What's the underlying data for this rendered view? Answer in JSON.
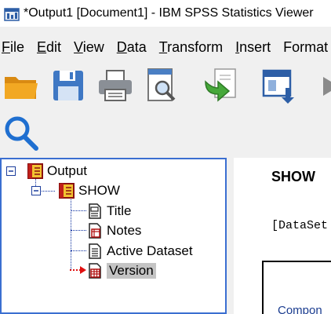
{
  "window": {
    "title": "*Output1 [Document1] - IBM SPSS Statistics Viewer"
  },
  "menu": [
    {
      "underline": "F",
      "rest": "ile"
    },
    {
      "underline": "E",
      "rest": "dit"
    },
    {
      "underline": "V",
      "rest": "iew"
    },
    {
      "underline": "D",
      "rest": "ata"
    },
    {
      "underline": "T",
      "rest": "ransform"
    },
    {
      "underline": "I",
      "rest": "nsert"
    },
    {
      "underline": "",
      "rest": "Format"
    }
  ],
  "toolbar": {
    "icons": [
      "open-folder-icon",
      "save-icon",
      "print-icon",
      "print-preview-icon",
      "export-icon",
      "recall-dialog-icon",
      "arrow-icon"
    ],
    "row2": [
      "find-icon"
    ]
  },
  "outline": {
    "root": {
      "label": "Output",
      "expander": "minus"
    },
    "procedure": {
      "label": "SHOW",
      "expander": "minus"
    },
    "items": [
      {
        "label": "Title",
        "icon": "title-icon"
      },
      {
        "label": "Notes",
        "icon": "notes-icon"
      },
      {
        "label": "Active Dataset",
        "icon": "active-dataset-icon"
      },
      {
        "label": "Version",
        "icon": "version-icon",
        "selected": true
      }
    ]
  },
  "content": {
    "heading": "SHOW",
    "dataset": "[DataSet",
    "table_text": "Compon"
  },
  "colors": {
    "selection": "#c4c4c4",
    "tree_line": "#0b2f9f",
    "pane_border": "#3b6fd1",
    "arrow": "#e01010"
  }
}
